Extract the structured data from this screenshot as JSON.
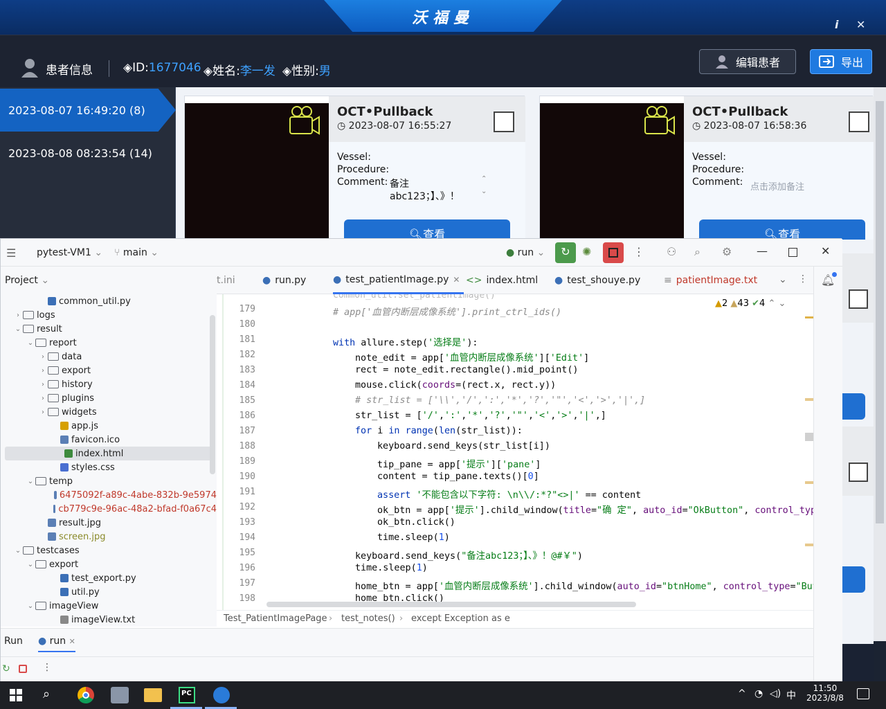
{
  "app": {
    "title": "沃福曼",
    "info_icon": "i",
    "close_icon": "✕"
  },
  "patient": {
    "section_label": "患者信息",
    "id_label": "◈ID:",
    "id_value": "1677046",
    "name_label": "◈姓名:",
    "name_value": "李一发",
    "sex_label": "◈性别:",
    "sex_value": "男",
    "edit_button": "编辑患者",
    "export_button": "导出"
  },
  "dates": [
    {
      "label": "2023-08-07 16:49:20  (8)",
      "active": true
    },
    {
      "label": "2023-08-08 08:23:54  (14)",
      "active": false
    }
  ],
  "cards": [
    {
      "title": "OCT•Pullback",
      "time": "2023-08-07 16:55:27",
      "vessel_label": "Vessel:",
      "procedure_label": "Procedure:",
      "comment_label": "Comment:",
      "comment_line1": "备注",
      "comment_line2": "abc123；】、》！",
      "view_button": "查看"
    },
    {
      "title": "OCT•Pullback",
      "time": "2023-08-07 16:58:36",
      "vessel_label": "Vessel:",
      "procedure_label": "Procedure:",
      "comment_label": "Comment:",
      "comment_placeholder": "点击添加备注",
      "view_button": "查看"
    }
  ],
  "ide": {
    "project_name": "pytest-VM1",
    "branch": "main",
    "run_config": "run",
    "project_label": "Project",
    "tabs": [
      "t.ini",
      "run.py",
      "test_patientImage.py",
      "index.html",
      "test_shouye.py",
      "patientImage.txt"
    ],
    "inspections": {
      "warnings": "2",
      "weak": "43",
      "ok": "4"
    },
    "tree": [
      {
        "indent": 3,
        "type": "py",
        "label": "common_util.py"
      },
      {
        "indent": 1,
        "type": "folder",
        "chev": "›",
        "label": "logs"
      },
      {
        "indent": 1,
        "type": "folder",
        "chev": "⌄",
        "label": "result"
      },
      {
        "indent": 2,
        "type": "folder",
        "chev": "⌄",
        "label": "report"
      },
      {
        "indent": 3,
        "type": "folder",
        "chev": "›",
        "label": "data"
      },
      {
        "indent": 3,
        "type": "folder",
        "chev": "›",
        "label": "export"
      },
      {
        "indent": 3,
        "type": "folder",
        "chev": "›",
        "label": "history"
      },
      {
        "indent": 3,
        "type": "folder",
        "chev": "›",
        "label": "plugins"
      },
      {
        "indent": 3,
        "type": "folder",
        "chev": "›",
        "label": "widgets"
      },
      {
        "indent": 4,
        "type": "js",
        "label": "app.js"
      },
      {
        "indent": 4,
        "type": "img",
        "label": "favicon.ico"
      },
      {
        "indent": 4,
        "type": "html",
        "label": "index.html",
        "selected": true
      },
      {
        "indent": 4,
        "type": "css",
        "label": "styles.css"
      },
      {
        "indent": 2,
        "type": "folder",
        "chev": "⌄",
        "label": "temp"
      },
      {
        "indent": 4,
        "type": "img",
        "label": "6475092f-a89c-4abe-832b-9e5974",
        "red": true
      },
      {
        "indent": 4,
        "type": "img",
        "label": "cb779c9e-96ac-48a2-bfad-f0a67c4",
        "red": true
      },
      {
        "indent": 3,
        "type": "img",
        "label": "result.jpg"
      },
      {
        "indent": 3,
        "type": "img",
        "label": "screen.jpg",
        "olive": true
      },
      {
        "indent": 1,
        "type": "folder",
        "chev": "⌄",
        "label": "testcases"
      },
      {
        "indent": 2,
        "type": "folder",
        "chev": "⌄",
        "label": "export"
      },
      {
        "indent": 4,
        "type": "py",
        "label": "test_export.py"
      },
      {
        "indent": 4,
        "type": "py",
        "label": "util.py"
      },
      {
        "indent": 2,
        "type": "folder",
        "chev": "⌄",
        "label": "imageView"
      },
      {
        "indent": 4,
        "type": "txt",
        "label": "imageView.txt"
      }
    ],
    "code_lines": [
      {
        "n": "179",
        "indent": 0,
        "html": "<span class='cmt'># app['血管内断层成像系统'].print_ctrl_ids()</span>"
      },
      {
        "n": "180",
        "indent": 0,
        "html": ""
      },
      {
        "n": "181",
        "indent": 0,
        "html": "<span class='kw'>with</span> allure.step(<span class='str'>'选择是'</span>):"
      },
      {
        "n": "182",
        "indent": 1,
        "html": "note_edit = app[<span class='str'>'血管内断层成像系统'</span>][<span class='str'>'Edit'</span>]"
      },
      {
        "n": "183",
        "indent": 1,
        "html": "rect = note_edit.rectangle().mid_point()"
      },
      {
        "n": "184",
        "indent": 1,
        "html": "mouse.click(<span class='param'>coords</span>=(rect.x, rect.y))"
      },
      {
        "n": "185",
        "indent": 1,
        "html": "<span class='cmt'># str_list = ['\\\\','/',':','*','?','\"','&lt;','&gt;','|',]</span>"
      },
      {
        "n": "186",
        "indent": 1,
        "html": "str_list = [<span class='str'>'/'</span>,<span class='str'>':'</span>,<span class='str'>'*'</span>,<span class='str'>'?'</span>,<span class='str'>'\"'</span>,<span class='str'>'&lt;'</span>,<span class='str'>'&gt;'</span>,<span class='str'>'|'</span>,]"
      },
      {
        "n": "187",
        "indent": 1,
        "html": "<span class='kw'>for</span> i <span class='kw'>in</span> <span class='kw'>range</span>(<span class='kw'>len</span>(str_list)):"
      },
      {
        "n": "188",
        "indent": 2,
        "html": "keyboard.send_keys(str_list[i])"
      },
      {
        "n": "189",
        "indent": 2,
        "html": "tip_pane = app[<span class='str'>'提示'</span>][<span class='str'>'pane'</span>]"
      },
      {
        "n": "190",
        "indent": 2,
        "html": "content = tip_pane.texts()[<span class='num'>0</span>]"
      },
      {
        "n": "191",
        "indent": 2,
        "html": "<span class='kw'>assert</span> <span class='str'>'不能包含以下字符: \\n\\\\/:*?\"&lt;&gt;|'</span> == content"
      },
      {
        "n": "192",
        "indent": 2,
        "html": "ok_btn = app[<span class='str'>'提示'</span>].child_window(<span class='param'>title</span>=<span class='str'>\"确 定\"</span>, <span class='param'>auto_id</span>=<span class='str'>\"OkButton\"</span>, <span class='param'>control_type</span>"
      },
      {
        "n": "193",
        "indent": 2,
        "html": "ok_btn.click()"
      },
      {
        "n": "194",
        "indent": 2,
        "html": "time.sleep(<span class='num'>1</span>)"
      },
      {
        "n": "195",
        "indent": 1,
        "html": "keyboard.send_keys(<span class='str'>\"备注abc123；】、》！@#￥\"</span>)"
      },
      {
        "n": "196",
        "indent": 1,
        "html": "time.sleep(<span class='num'>1</span>)"
      },
      {
        "n": "197",
        "indent": 1,
        "html": "home_btn = app[<span class='str'>'血管内断层成像系统'</span>].child_window(<span class='param'>auto_id</span>=<span class='str'>\"btnHome\"</span>, <span class='param'>control_type</span>=<span class='str'>\"Butt</span>"
      },
      {
        "n": "198",
        "indent": 1,
        "html": "home_btn.click()"
      }
    ],
    "breadcrumb": [
      "Test_PatientImagePage",
      "test_notes()",
      "except Exception as e"
    ],
    "run_tab_label": "Run",
    "run_config_tab": "run"
  },
  "taskbar": {
    "time": "11:50",
    "date": "2023/8/8",
    "ime": "中"
  }
}
